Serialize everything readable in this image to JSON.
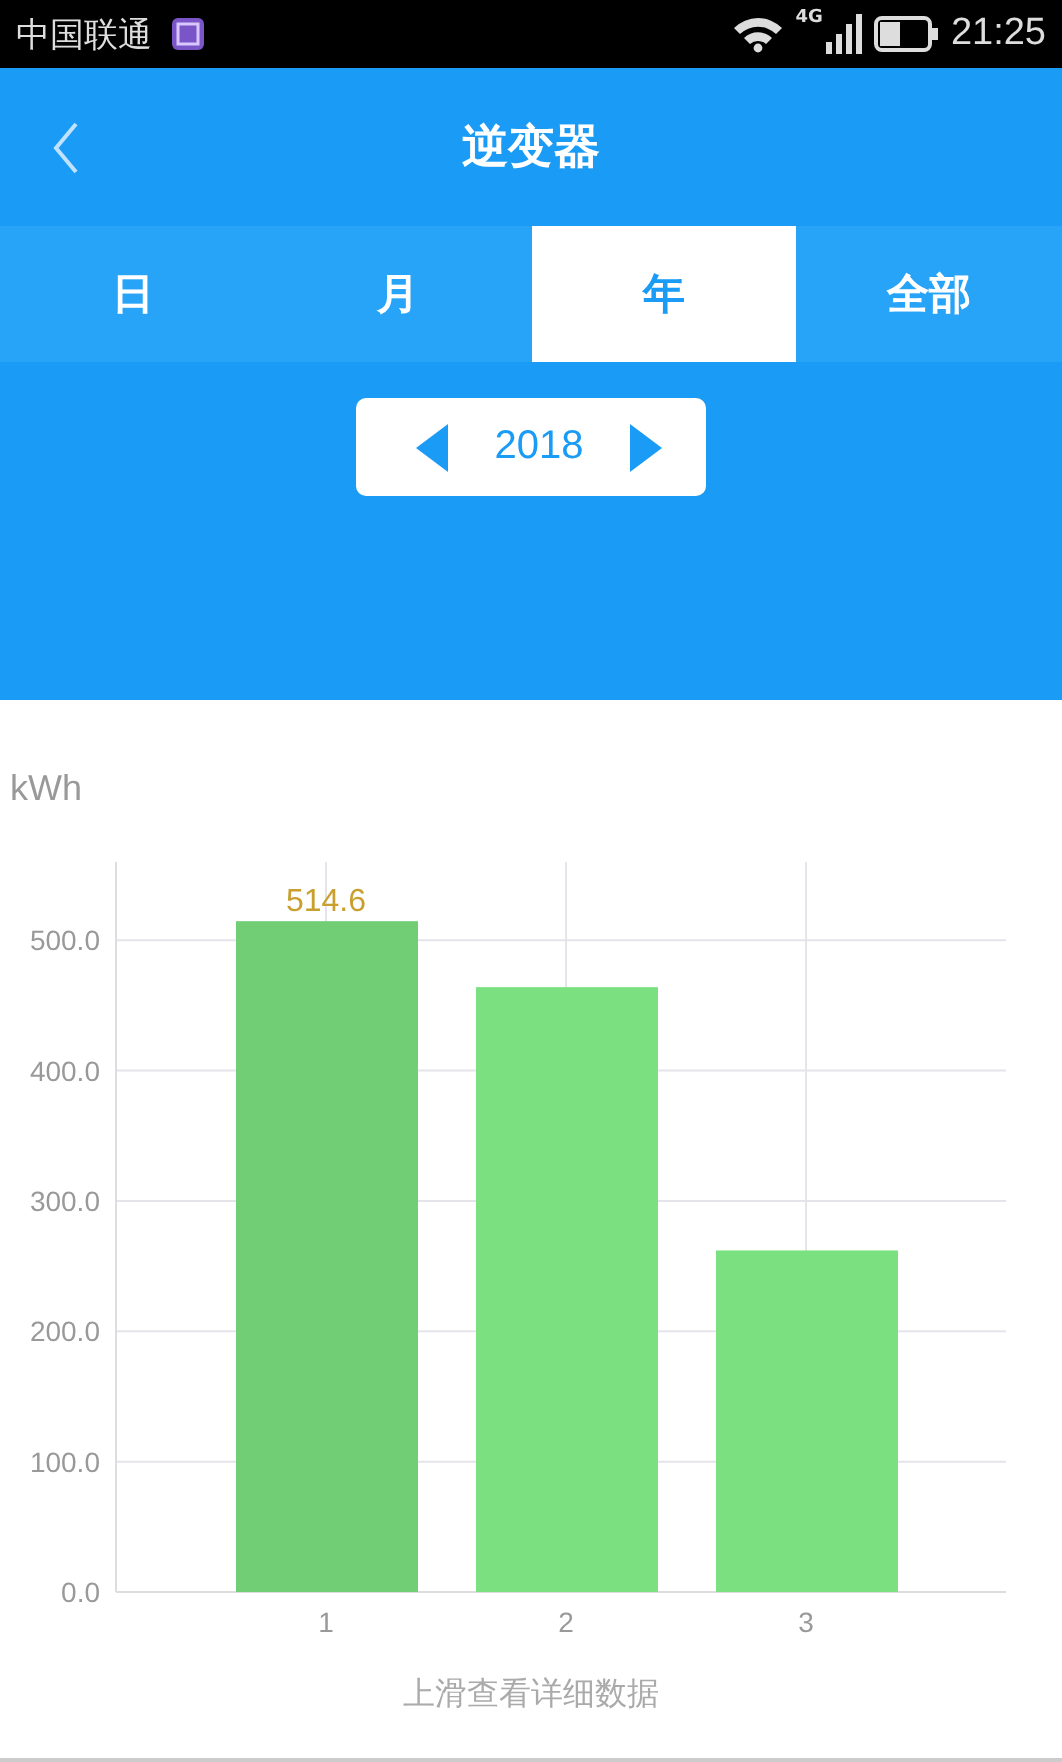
{
  "status_bar": {
    "carrier": "中国联通",
    "network": "4G",
    "time": "21:25"
  },
  "header": {
    "title": "逆变器"
  },
  "tabs": [
    {
      "label": "日",
      "selected": false
    },
    {
      "label": "月",
      "selected": false
    },
    {
      "label": "年",
      "selected": true
    },
    {
      "label": "全部",
      "selected": false
    }
  ],
  "year_picker": {
    "value": "2018"
  },
  "chart": {
    "chart_data": {
      "type": "bar",
      "grid": true,
      "categories": [
        "1",
        "2",
        "3"
      ],
      "ylabel": "kWh",
      "ylim": [
        0,
        560
      ],
      "yticks": [
        {
          "value": 0,
          "label": "0.0"
        },
        {
          "value": 100,
          "label": "100.0"
        },
        {
          "value": 200,
          "label": "200.0"
        },
        {
          "value": 300,
          "label": "300.0"
        },
        {
          "value": 400,
          "label": "400.0"
        },
        {
          "value": 500,
          "label": "500.0"
        }
      ],
      "series": [
        {
          "color": "#7be07f",
          "values": [
            514.6,
            464,
            262
          ]
        }
      ],
      "value_labels": [
        "514.6",
        null,
        null
      ]
    }
  },
  "hint": "上滑查看详细数据"
}
